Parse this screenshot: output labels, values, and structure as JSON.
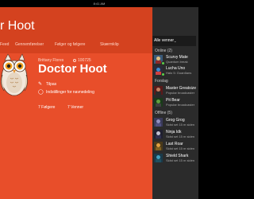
{
  "statusbar": {
    "time": "8:41 AM"
  },
  "header": {
    "title": "r Hoot"
  },
  "tabs": [
    {
      "label": "Feed"
    },
    {
      "label": "Gennemførelser"
    },
    {
      "label": "Følger og følgere"
    },
    {
      "label": "Skærmklip"
    }
  ],
  "profile": {
    "real_name": "Brittany Flores",
    "gamerscore": "100725",
    "gamertag": "Doctor Hoot",
    "actions": [
      {
        "label": "Tilpas",
        "icon": "pencil-icon"
      },
      {
        "label": "Indstillinger for navnedeling",
        "icon": "shield-icon"
      }
    ],
    "followers": "7 Følgere",
    "friends": "7 Venner"
  },
  "friends_panel": {
    "filter": "Alle venner",
    "sections": {
      "online": "Online (2)",
      "suggested": "Forslag",
      "offline": "Offline (5)"
    },
    "online": [
      {
        "name": "Scurvy Mate",
        "status": "Quantum break",
        "presence": "online"
      },
      {
        "name": "Lucha Uno",
        "status": "Halo 5: Guardians",
        "presence": "online"
      }
    ],
    "suggested": [
      {
        "name": "Master Greatsize",
        "status": "Popular broadcaster"
      },
      {
        "name": "Pit Bear",
        "status": "Popular broadcaster"
      }
    ],
    "offline": [
      {
        "name": "Grog Grog",
        "status": "Sidst set 15 m siden"
      },
      {
        "name": "Ninja Idk",
        "status": "Sidst set 15 m siden"
      },
      {
        "name": "Last Roar",
        "status": "Sidst set 15 m siden"
      },
      {
        "name": "Shield Shark",
        "status": "Sidst set 15 m siden"
      }
    ]
  },
  "colors": {
    "accent": "#d4421f",
    "panel": "#e84e2a",
    "sidebar": "#2b2b2b",
    "online": "#5bd04a"
  }
}
